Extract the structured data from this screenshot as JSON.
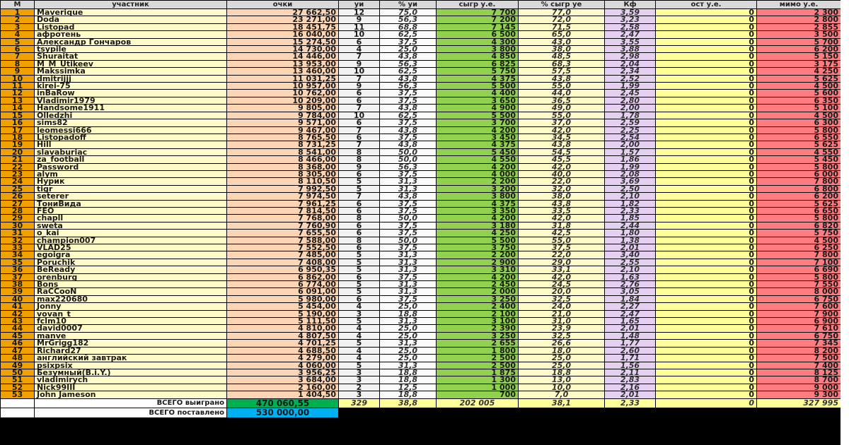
{
  "headers": [
    "М",
    "участник",
    "очки",
    "уи",
    "% уи",
    "сыгр у.е.",
    "% сыгр уе",
    "Кф",
    "ост у.е.",
    "мимо у.е."
  ],
  "rows": [
    [
      "1",
      "Maverique",
      "27 662,50",
      "12",
      "75,0",
      "7 700",
      "77,0",
      "3,59",
      "0",
      "2 300"
    ],
    [
      "2",
      "Doda",
      "23 271,00",
      "9",
      "56,3",
      "7 200",
      "72,0",
      "3,23",
      "0",
      "2 800"
    ],
    [
      "3",
      "Listopad",
      "18 451,75",
      "11",
      "68,8",
      "7 145",
      "71,5",
      "2,58",
      "0",
      "2 855"
    ],
    [
      "4",
      "афротень",
      "16 040,00",
      "10",
      "62,5",
      "6 500",
      "65,0",
      "2,47",
      "0",
      "3 500"
    ],
    [
      "5",
      "Александр Гончаров",
      "15 274,50",
      "6",
      "37,5",
      "4 300",
      "43,0",
      "3,55",
      "0",
      "5 700"
    ],
    [
      "6",
      "tsypile",
      "14 730,00",
      "4",
      "25,0",
      "3 800",
      "38,0",
      "3,88",
      "0",
      "6 200"
    ],
    [
      "7",
      "Shuraitat",
      "14 446,00",
      "7",
      "43,8",
      "4 850",
      "48,5",
      "2,98",
      "0",
      "5 150"
    ],
    [
      "8",
      "M_M_Utikeev",
      "13 953,00",
      "9",
      "56,3",
      "6 825",
      "68,3",
      "2,04",
      "0",
      "3 175"
    ],
    [
      "9",
      "Makssimka",
      "13 460,00",
      "10",
      "62,5",
      "5 750",
      "57,5",
      "2,34",
      "0",
      "4 250"
    ],
    [
      "10",
      "dmitrijjj",
      "11 031,25",
      "7",
      "43,8",
      "4 375",
      "43,8",
      "2,52",
      "0",
      "5 625"
    ],
    [
      "11",
      "kirei-75",
      "10 957,00",
      "9",
      "56,3",
      "5 500",
      "55,0",
      "1,99",
      "0",
      "4 500"
    ],
    [
      "12",
      "inBaRow",
      "10 762,00",
      "6",
      "37,5",
      "4 400",
      "44,0",
      "2,45",
      "0",
      "5 600"
    ],
    [
      "13",
      "Vladimir1979",
      "10 209,00",
      "6",
      "37,5",
      "3 650",
      "36,5",
      "2,80",
      "0",
      "6 350"
    ],
    [
      "14",
      "Handsome1911",
      "9 805,00",
      "7",
      "43,8",
      "4 900",
      "49,0",
      "2,00",
      "0",
      "5 100"
    ],
    [
      "15",
      "Olledzhi",
      "9 784,00",
      "10",
      "62,5",
      "5 500",
      "55,0",
      "1,78",
      "0",
      "4 500"
    ],
    [
      "16",
      "sims82",
      "9 571,00",
      "6",
      "37,5",
      "3 700",
      "37,0",
      "2,59",
      "0",
      "6 300"
    ],
    [
      "17",
      "leomessi666",
      "9 467,00",
      "7",
      "43,8",
      "4 200",
      "42,0",
      "2,25",
      "0",
      "5 800"
    ],
    [
      "18",
      "Listopadoff",
      "8 765,50",
      "6",
      "37,5",
      "3 450",
      "34,5",
      "2,54",
      "0",
      "6 550"
    ],
    [
      "19",
      "Hill",
      "8 731,25",
      "7",
      "43,8",
      "4 375",
      "43,8",
      "2,00",
      "0",
      "5 625"
    ],
    [
      "20",
      "slavaburiac",
      "8 541,00",
      "8",
      "50,0",
      "5 450",
      "54,5",
      "1,57",
      "0",
      "4 550"
    ],
    [
      "21",
      "za_football",
      "8 466,00",
      "8",
      "50,0",
      "4 550",
      "45,5",
      "1,86",
      "0",
      "5 450"
    ],
    [
      "22",
      "Password",
      "8 368,00",
      "9",
      "56,3",
      "4 200",
      "42,0",
      "1,99",
      "0",
      "5 800"
    ],
    [
      "23",
      "alym",
      "8 305,00",
      "6",
      "37,5",
      "4 000",
      "40,0",
      "2,08",
      "0",
      "6 000"
    ],
    [
      "24",
      "Нурик",
      "8 110,50",
      "5",
      "31,3",
      "2 200",
      "22,0",
      "3,69",
      "0",
      "7 800"
    ],
    [
      "25",
      "tigr",
      "7 992,50",
      "5",
      "31,3",
      "3 200",
      "32,0",
      "2,50",
      "0",
      "6 800"
    ],
    [
      "26",
      "seterer",
      "7 974,50",
      "7",
      "43,8",
      "3 800",
      "38,0",
      "2,10",
      "0",
      "6 200"
    ],
    [
      "27",
      "ТониВида",
      "7 961,25",
      "6",
      "37,5",
      "4 375",
      "43,8",
      "1,82",
      "0",
      "5 625"
    ],
    [
      "28",
      "FEO",
      "7 814,50",
      "6",
      "37,5",
      "3 350",
      "33,5",
      "2,33",
      "0",
      "6 650"
    ],
    [
      "29",
      "chapll",
      "7 768,00",
      "8",
      "50,0",
      "4 200",
      "42,0",
      "1,85",
      "0",
      "5 800"
    ],
    [
      "30",
      "sweta",
      "7 760,90",
      "6",
      "37,5",
      "3 180",
      "31,8",
      "2,44",
      "0",
      "6 820"
    ],
    [
      "31",
      "o_kai",
      "7 655,50",
      "6",
      "37,5",
      "4 250",
      "42,5",
      "1,80",
      "0",
      "5 750"
    ],
    [
      "32",
      "champion007",
      "7 588,00",
      "8",
      "50,0",
      "5 500",
      "55,0",
      "1,38",
      "0",
      "4 500"
    ],
    [
      "33",
      "VLAD25",
      "7 552,50",
      "6",
      "37,5",
      "3 750",
      "37,5",
      "2,01",
      "0",
      "6 250"
    ],
    [
      "34",
      "egoigra",
      "7 485,00",
      "5",
      "31,3",
      "2 200",
      "22,0",
      "3,40",
      "0",
      "7 800"
    ],
    [
      "35",
      "Poruchik",
      "7 408,00",
      "5",
      "31,3",
      "2 900",
      "29,0",
      "2,55",
      "0",
      "7 100"
    ],
    [
      "36",
      "BeReady",
      "6 950,35",
      "5",
      "31,3",
      "3 310",
      "33,1",
      "2,10",
      "0",
      "6 690"
    ],
    [
      "37",
      "orenburg",
      "6 862,00",
      "6",
      "37,5",
      "4 200",
      "42,0",
      "1,63",
      "0",
      "5 800"
    ],
    [
      "38",
      "Bons",
      "6 774,00",
      "5",
      "31,3",
      "2 450",
      "24,5",
      "2,76",
      "0",
      "7 550"
    ],
    [
      "39",
      "RaCCooN",
      "6 091,00",
      "5",
      "31,3",
      "2 000",
      "20,0",
      "3,05",
      "0",
      "8 000"
    ],
    [
      "40",
      "max220680",
      "5 980,00",
      "6",
      "37,5",
      "3 250",
      "32,5",
      "1,84",
      "0",
      "6 750"
    ],
    [
      "41",
      "Jonny",
      "5 454,00",
      "4",
      "25,0",
      "2 400",
      "24,0",
      "2,27",
      "0",
      "7 600"
    ],
    [
      "42",
      "vovan_t",
      "5 190,00",
      "3",
      "18,8",
      "2 100",
      "21,0",
      "2,47",
      "0",
      "7 900"
    ],
    [
      "43",
      "fclm10",
      "5 111,50",
      "5",
      "31,3",
      "3 100",
      "31,0",
      "1,65",
      "0",
      "6 900"
    ],
    [
      "44",
      "david0007",
      "4 810,00",
      "4",
      "25,0",
      "2 390",
      "23,9",
      "2,01",
      "0",
      "7 610"
    ],
    [
      "45",
      "manve",
      "4 807,50",
      "4",
      "25,0",
      "3 250",
      "32,5",
      "1,48",
      "0",
      "6 750"
    ],
    [
      "46",
      "MrGrigg182",
      "4 701,25",
      "5",
      "31,3",
      "2 655",
      "26,6",
      "1,77",
      "0",
      "7 345"
    ],
    [
      "47",
      "Richard27",
      "4 688,50",
      "4",
      "25,0",
      "1 800",
      "18,0",
      "2,60",
      "0",
      "8 200"
    ],
    [
      "48",
      "английский завтрак",
      "4 279,00",
      "4",
      "25,0",
      "2 500",
      "25,0",
      "1,71",
      "0",
      "7 500"
    ],
    [
      "49",
      "psixpsix",
      "4 060,00",
      "5",
      "31,3",
      "2 500",
      "25,0",
      "1,56",
      "0",
      "7 400"
    ],
    [
      "50",
      "Безумный(B.i.Y.)",
      "3 956,25",
      "3",
      "18,8",
      "1 875",
      "18,8",
      "2,11",
      "0",
      "8 125"
    ],
    [
      "51",
      "vladimirych",
      "3 684,00",
      "3",
      "18,8",
      "1 300",
      "13,0",
      "2,83",
      "0",
      "8 700"
    ],
    [
      "52",
      "Nick99III",
      "2 160,00",
      "2",
      "12,5",
      "1 000",
      "10,0",
      "2,16",
      "0",
      "9 000"
    ],
    [
      "53",
      "John Jameson",
      "1 404,50",
      "3",
      "18,8",
      "700",
      "7,0",
      "2,01",
      "0",
      "9 300"
    ]
  ],
  "totals": {
    "won_label": "ВСЕГО выиграно",
    "won_value": "470 060,55",
    "yi": "329",
    "pyi": "38,8",
    "played": "202 005",
    "pplayed": "38,1",
    "kf": "2,33",
    "ost": "0",
    "miss": "327 995",
    "bet_label": "ВСЕГО поставлено",
    "bet_value": "530 000,00"
  }
}
